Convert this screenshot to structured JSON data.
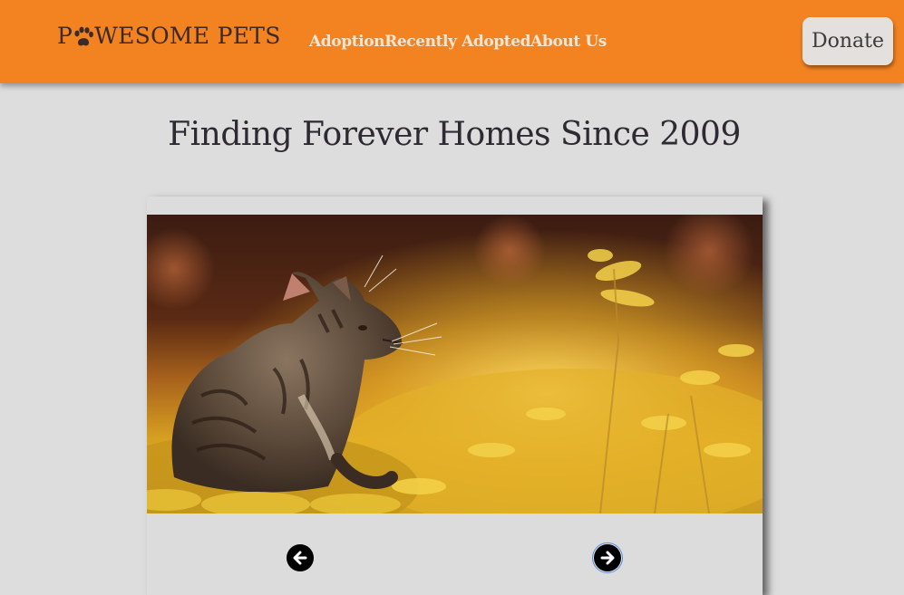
{
  "header": {
    "logo_before": "P",
    "logo_after": "WESOME PETS",
    "logo_icon": "paw-icon",
    "nav": [
      {
        "label": "Adoption"
      },
      {
        "label": "Recently Adopted"
      },
      {
        "label": "About Us"
      }
    ],
    "donate_label": "Donate"
  },
  "main": {
    "title": "Finding Forever Homes Since 2009"
  },
  "carousel": {
    "image_icon": "kitten-photo",
    "prev_icon": "arrow-left-icon",
    "next_icon": "arrow-right-icon"
  },
  "colors": {
    "header_bg": "#f38321",
    "page_bg": "#dddddd",
    "nav_text": "#f3e6d6"
  }
}
